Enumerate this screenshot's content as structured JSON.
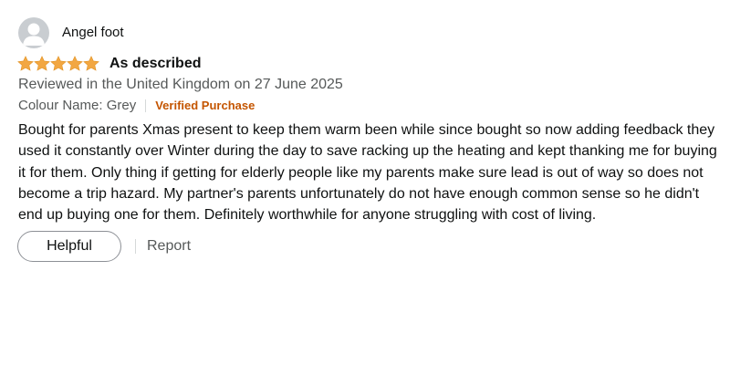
{
  "reviewer": {
    "name": "Angel foot",
    "avatar_icon": "default-user-avatar-icon"
  },
  "rating": {
    "stars": 5,
    "max": 5,
    "star_color": "#f2a742",
    "star_icon": "star-icon"
  },
  "review": {
    "title": "As described",
    "date_line": "Reviewed in the United Kingdom on 27 June 2025",
    "format": "Colour Name: Grey",
    "verified_label": "Verified Purchase",
    "body": "Bought for parents Xmas present to keep them warm been while since bought so now adding feedback they used it constantly over Winter during the day to save racking up the heating and kept thanking me for buying it for them. Only thing if getting for elderly people like my parents make sure lead is out of way so does not become a trip hazard. My partner's parents unfortunately do not have enough common sense so he didn't end up buying one for them. Definitely worthwhile for anyone struggling with cost of living."
  },
  "actions": {
    "helpful_label": "Helpful",
    "report_label": "Report"
  },
  "colors": {
    "text_primary": "#0f1111",
    "text_secondary": "#565959",
    "verified": "#c45500",
    "star": "#f2a742"
  }
}
